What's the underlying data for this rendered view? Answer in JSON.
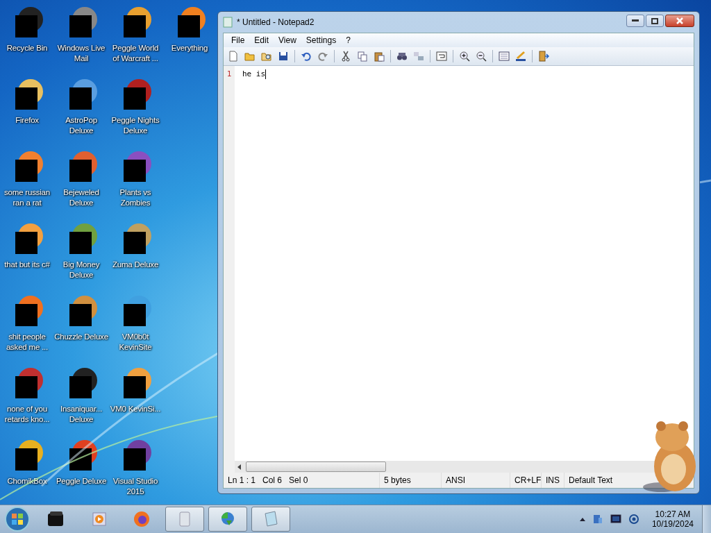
{
  "desktop_icons": [
    {
      "label": "Recycle Bin"
    },
    {
      "label": "Firefox"
    },
    {
      "label": "some russian ran a rat"
    },
    {
      "label": "that but its c#"
    },
    {
      "label": "shit people asked me ..."
    },
    {
      "label": "none of you retards kno..."
    },
    {
      "label": "ChomikBox"
    },
    {
      "label": "Windows Live Mail"
    },
    {
      "label": "AstroPop Deluxe"
    },
    {
      "label": "Bejeweled Deluxe"
    },
    {
      "label": "Big Money Deluxe"
    },
    {
      "label": "Chuzzle Deluxe"
    },
    {
      "label": "Insaniquar... Deluxe"
    },
    {
      "label": "Peggle Deluxe"
    },
    {
      "label": "Peggle World of Warcraft ..."
    },
    {
      "label": "Peggle Nights Deluxe"
    },
    {
      "label": "Plants vs Zombies"
    },
    {
      "label": "Zuma Deluxe"
    },
    {
      "label": "VM0b0t KevinSite"
    },
    {
      "label": "VM0 KevinSi..."
    },
    {
      "label": "Visual Studio 2015"
    },
    {
      "label": "Everything"
    }
  ],
  "window": {
    "title": "* Untitled - Notepad2"
  },
  "menu": [
    "File",
    "Edit",
    "View",
    "Settings",
    "?"
  ],
  "editor": {
    "lines": [
      {
        "number": "1",
        "text": "he is"
      }
    ]
  },
  "status_bar": {
    "position": "Ln 1 : 1",
    "column": "Col 6",
    "selection": "Sel 0",
    "size": "5 bytes",
    "encoding": "ANSI",
    "line_ending": "CR+LF",
    "mode": "INS",
    "scheme": "Default Text"
  },
  "taskbar": {
    "buttons": [
      {
        "active": false
      },
      {
        "active": false
      },
      {
        "active": false
      },
      {
        "active": true
      },
      {
        "active": true
      },
      {
        "active": true
      }
    ],
    "clock": {
      "time": "10:27 AM",
      "date": "10/19/2024"
    }
  }
}
